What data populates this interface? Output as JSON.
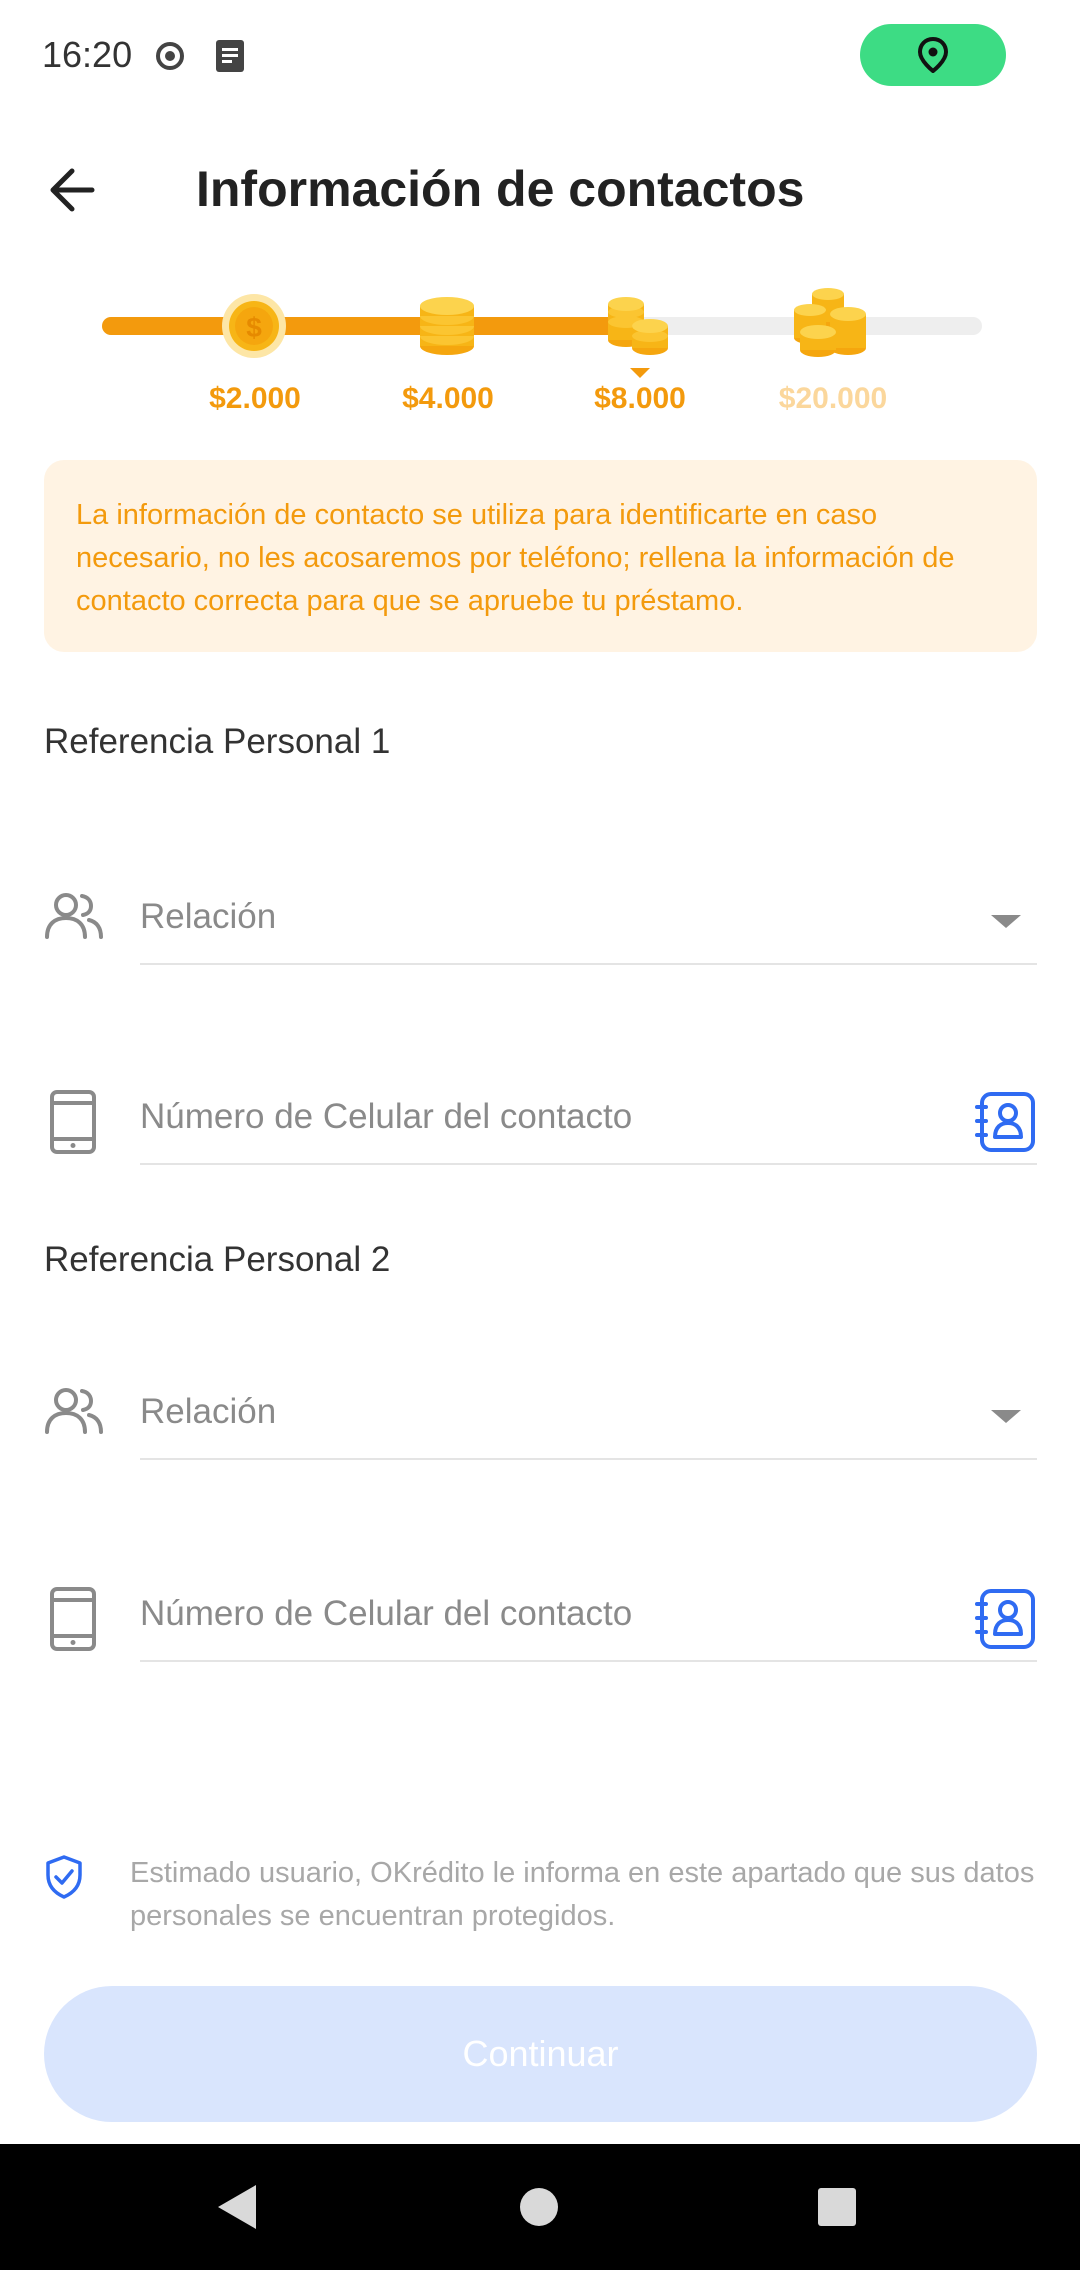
{
  "status_bar": {
    "time": "16:20",
    "icons": [
      "record-icon",
      "document-icon",
      "location-icon"
    ],
    "location_pill_color": "#3ddc84"
  },
  "header": {
    "title": "Información de contactos",
    "back_icon": "arrow-left-icon"
  },
  "progress": {
    "accent_color": "#f39a0d",
    "current_step": 3,
    "steps": [
      {
        "label": "$2.000",
        "reached": true
      },
      {
        "label": "$4.000",
        "reached": true
      },
      {
        "label": "$8.000",
        "reached": true
      },
      {
        "label": "$20.000",
        "reached": false
      }
    ]
  },
  "notice": {
    "text": "La información de contacto se utiliza para identificarte en caso necesario, no les acosaremos por teléfono; rellena la información de contacto correcta para que se apruebe tu préstamo."
  },
  "references": [
    {
      "title": "Referencia Personal 1",
      "relation_placeholder": "Relación",
      "phone_placeholder": "Número de Celular del contacto"
    },
    {
      "title": "Referencia Personal 2",
      "relation_placeholder": "Relación",
      "phone_placeholder": "Número de Celular del contacto"
    }
  ],
  "privacy": {
    "text": "Estimado usuario, OKrédito le informa en este apartado que sus datos personales se encuentran protegidos."
  },
  "continue_button": {
    "label": "Continuar",
    "enabled": false,
    "color": "#d9e5fd"
  },
  "colors": {
    "link_blue": "#2f6bf2",
    "muted_text": "#8a8a8a"
  }
}
